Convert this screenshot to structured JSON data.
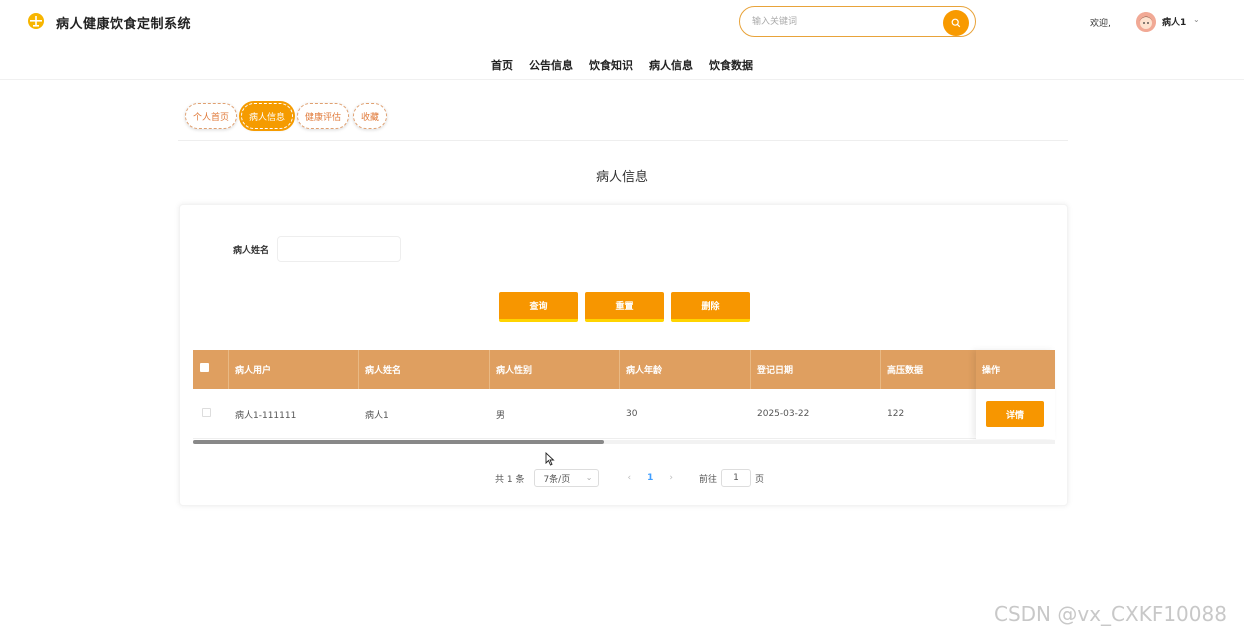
{
  "header": {
    "title": "病人健康饮食定制系统",
    "search_placeholder": "输入关键词",
    "welcome": "欢迎,",
    "username": "病人1",
    "logo_icon": "balance-scale-icon",
    "accent": "#f79600"
  },
  "nav": {
    "items": [
      "首页",
      "公告信息",
      "饮食知识",
      "病人信息",
      "饮食数据"
    ]
  },
  "subtabs": {
    "items": [
      "个人首页",
      "病人信息",
      "健康评估",
      "收藏"
    ],
    "active": "病人信息"
  },
  "page": {
    "heading": "病人信息"
  },
  "filter": {
    "name_label": "病人姓名",
    "name_value": ""
  },
  "actions": {
    "query": "查询",
    "reset": "重置",
    "delete": "删除"
  },
  "table": {
    "columns": [
      "病人用户",
      "病人姓名",
      "病人性别",
      "病人年龄",
      "登记日期",
      "高压数据",
      "操作"
    ],
    "rows": [
      {
        "user": "病人1-111111",
        "name": "病人1",
        "gender": "男",
        "age": "30",
        "date": "2025-03-22",
        "bp_high": "122",
        "action": "详情"
      }
    ],
    "header_color": "#df9f60"
  },
  "pagination": {
    "total": "共 1 条",
    "page_size": "7条/页",
    "current": "1",
    "goto_label": "前往",
    "goto_value": "1",
    "page_suffix": "页"
  },
  "watermark": "CSDN @vx_CXKF10088"
}
